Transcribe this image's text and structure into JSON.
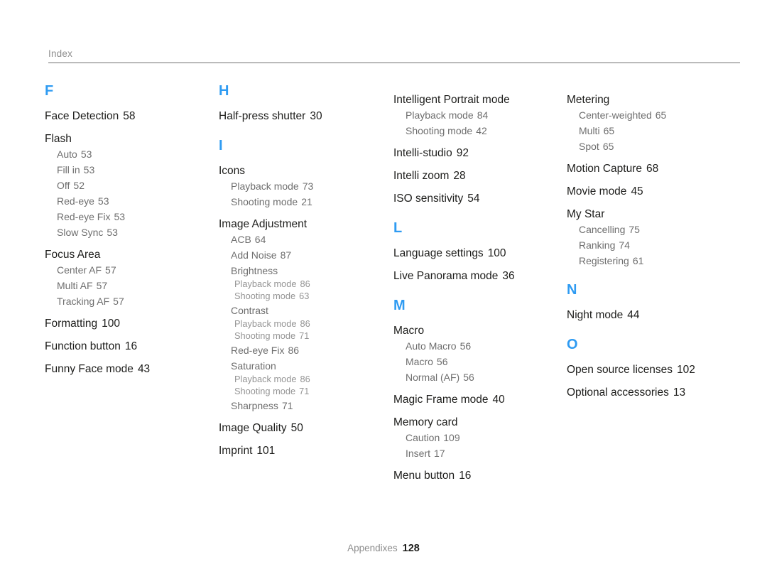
{
  "header": {
    "label": "Index"
  },
  "footer": {
    "label": "Appendixes",
    "page": "128"
  },
  "colors": {
    "letter_heading": "#2f9bf2",
    "entry_text": "#1d1d1b",
    "sub_entry_text": "#6e6e6e",
    "subsub_entry_text": "#949494",
    "rule": "#6f6f6f",
    "muted": "#8d8d8d"
  },
  "columns": [
    {
      "sections": [
        {
          "letter": "F",
          "entries": [
            {
              "level": 1,
              "text": "Face Detection",
              "page": "58"
            },
            {
              "level": 1,
              "text": "Flash",
              "page": ""
            },
            {
              "level": 2,
              "text": "Auto",
              "page": "53"
            },
            {
              "level": 2,
              "text": "Fill in",
              "page": "53"
            },
            {
              "level": 2,
              "text": "Off",
              "page": "52"
            },
            {
              "level": 2,
              "text": "Red-eye",
              "page": "53"
            },
            {
              "level": 2,
              "text": "Red-eye Fix",
              "page": "53"
            },
            {
              "level": 2,
              "text": "Slow Sync",
              "page": "53"
            },
            {
              "level": 1,
              "text": "Focus Area",
              "page": ""
            },
            {
              "level": 2,
              "text": "Center AF",
              "page": "57"
            },
            {
              "level": 2,
              "text": "Multi AF",
              "page": "57"
            },
            {
              "level": 2,
              "text": "Tracking AF",
              "page": "57"
            },
            {
              "level": 1,
              "text": "Formatting",
              "page": "100"
            },
            {
              "level": 1,
              "text": "Function button",
              "page": "16"
            },
            {
              "level": 1,
              "text": "Funny Face mode",
              "page": "43"
            }
          ]
        }
      ]
    },
    {
      "sections": [
        {
          "letter": "H",
          "entries": [
            {
              "level": 1,
              "text": "Half-press shutter",
              "page": "30"
            }
          ]
        },
        {
          "letter": "I",
          "entries": [
            {
              "level": 1,
              "text": "Icons",
              "page": ""
            },
            {
              "level": 2,
              "text": "Playback mode",
              "page": "73"
            },
            {
              "level": 2,
              "text": "Shooting mode",
              "page": "21"
            },
            {
              "level": 1,
              "text": "Image Adjustment",
              "page": ""
            },
            {
              "level": 2,
              "text": "ACB",
              "page": "64"
            },
            {
              "level": 2,
              "text": "Add Noise",
              "page": "87"
            },
            {
              "level": 2,
              "text": "Brightness",
              "page": ""
            },
            {
              "level": 3,
              "text": "Playback mode",
              "page": "86"
            },
            {
              "level": 3,
              "text": "Shooting mode",
              "page": "63"
            },
            {
              "level": 2,
              "text": "Contrast",
              "page": ""
            },
            {
              "level": 3,
              "text": "Playback mode",
              "page": "86"
            },
            {
              "level": 3,
              "text": "Shooting mode",
              "page": "71"
            },
            {
              "level": 2,
              "text": "Red-eye Fix",
              "page": "86"
            },
            {
              "level": 2,
              "text": "Saturation",
              "page": ""
            },
            {
              "level": 3,
              "text": "Playback mode",
              "page": "86"
            },
            {
              "level": 3,
              "text": "Shooting mode",
              "page": "71"
            },
            {
              "level": 2,
              "text": "Sharpness",
              "page": "71"
            },
            {
              "level": 1,
              "text": "Image Quality",
              "page": "50"
            },
            {
              "level": 1,
              "text": "Imprint",
              "page": "101"
            }
          ]
        }
      ]
    },
    {
      "sections": [
        {
          "letter": "",
          "entries": [
            {
              "level": 1,
              "text": "Intelligent Portrait mode",
              "page": ""
            },
            {
              "level": 2,
              "text": "Playback mode",
              "page": "84"
            },
            {
              "level": 2,
              "text": "Shooting mode",
              "page": "42"
            },
            {
              "level": 1,
              "text": "Intelli-studio",
              "page": "92"
            },
            {
              "level": 1,
              "text": "Intelli zoom",
              "page": "28"
            },
            {
              "level": 1,
              "text": "ISO sensitivity",
              "page": "54"
            }
          ]
        },
        {
          "letter": "L",
          "entries": [
            {
              "level": 1,
              "text": "Language settings",
              "page": "100"
            },
            {
              "level": 1,
              "text": "Live Panorama mode",
              "page": "36"
            }
          ]
        },
        {
          "letter": "M",
          "entries": [
            {
              "level": 1,
              "text": "Macro",
              "page": ""
            },
            {
              "level": 2,
              "text": "Auto Macro",
              "page": "56"
            },
            {
              "level": 2,
              "text": "Macro",
              "page": "56"
            },
            {
              "level": 2,
              "text": "Normal (AF)",
              "page": "56"
            },
            {
              "level": 1,
              "text": "Magic Frame mode",
              "page": "40"
            },
            {
              "level": 1,
              "text": "Memory card",
              "page": ""
            },
            {
              "level": 2,
              "text": "Caution",
              "page": "109"
            },
            {
              "level": 2,
              "text": "Insert",
              "page": "17"
            },
            {
              "level": 1,
              "text": "Menu button",
              "page": "16"
            }
          ]
        }
      ]
    },
    {
      "sections": [
        {
          "letter": "",
          "entries": [
            {
              "level": 1,
              "text": "Metering",
              "page": ""
            },
            {
              "level": 2,
              "text": "Center-weighted",
              "page": "65"
            },
            {
              "level": 2,
              "text": "Multi",
              "page": "65"
            },
            {
              "level": 2,
              "text": "Spot",
              "page": "65"
            },
            {
              "level": 1,
              "text": "Motion Capture",
              "page": "68"
            },
            {
              "level": 1,
              "text": "Movie mode",
              "page": "45"
            },
            {
              "level": 1,
              "text": "My Star",
              "page": ""
            },
            {
              "level": 2,
              "text": "Cancelling",
              "page": "75"
            },
            {
              "level": 2,
              "text": "Ranking",
              "page": "74"
            },
            {
              "level": 2,
              "text": "Registering",
              "page": "61"
            }
          ]
        },
        {
          "letter": "N",
          "entries": [
            {
              "level": 1,
              "text": "Night mode",
              "page": "44"
            }
          ]
        },
        {
          "letter": "O",
          "entries": [
            {
              "level": 1,
              "text": "Open source licenses",
              "page": "102"
            },
            {
              "level": 1,
              "text": "Optional accessories",
              "page": "13"
            }
          ]
        }
      ]
    }
  ]
}
